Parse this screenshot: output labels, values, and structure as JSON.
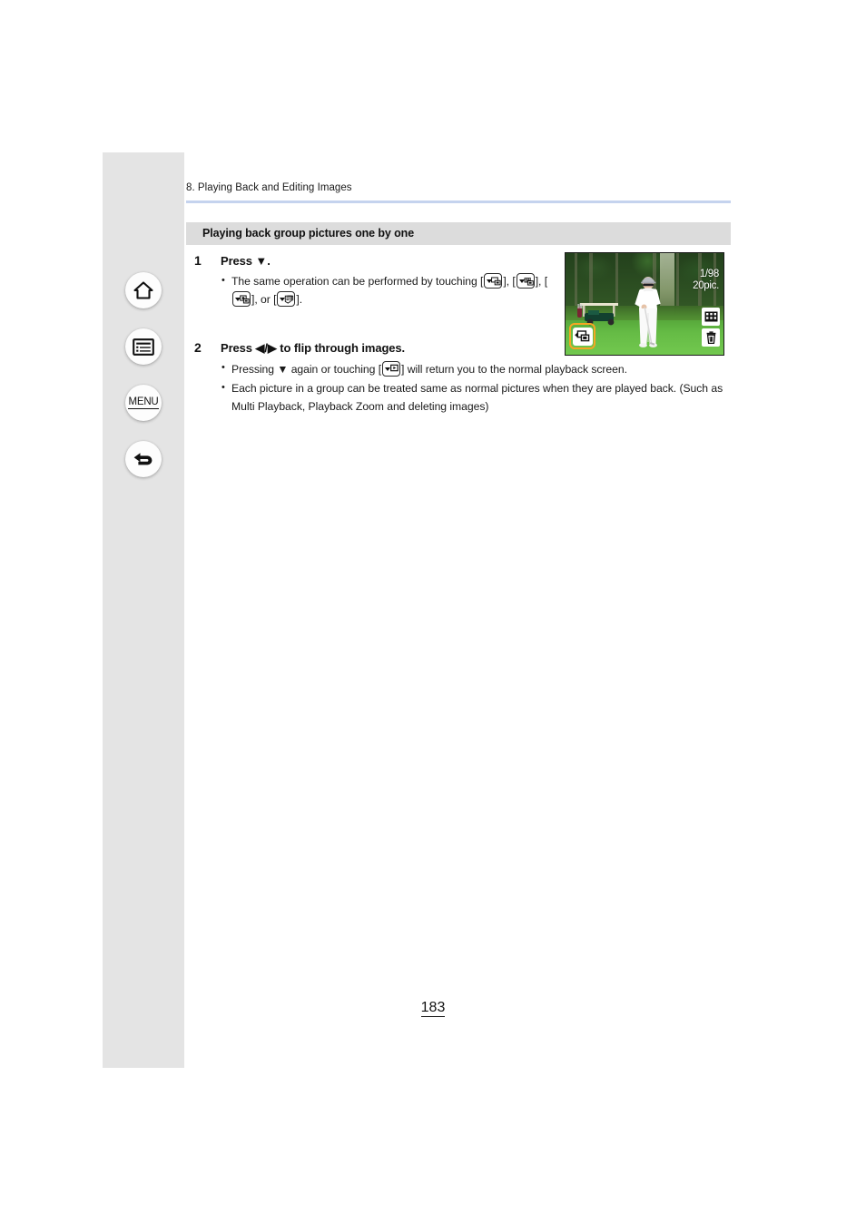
{
  "nav": {
    "items": [
      {
        "name": "home",
        "label": "Home",
        "icon": "home-icon"
      },
      {
        "name": "contents",
        "label": "Contents",
        "icon": "list-icon"
      },
      {
        "name": "menu",
        "label": "MENU",
        "icon": "menu-text"
      },
      {
        "name": "back",
        "label": "Back",
        "icon": "back-arrow-icon"
      }
    ]
  },
  "header": {
    "chapter": "8. Playing Back and Editing Images"
  },
  "section": {
    "title": "Playing back group pictures one by one"
  },
  "steps": [
    {
      "number": "1",
      "heading": "Press ▼.",
      "bullets": [
        {
          "pre": "The same operation can be performed by touching [",
          "mid1": "], [",
          "mid2": "], [",
          "mid3": "], or [",
          "post": "]."
        }
      ]
    },
    {
      "number": "2",
      "heading": "Press ◀/▶ to flip through images.",
      "bullets": [
        {
          "pre": "Pressing ▼ again or touching [",
          "post": "] will return you to the normal playback screen."
        },
        {
          "text": "Each picture in a group can be treated same as normal pictures when they are played back. (Such as Multi Playback, Playback Zoom and deleting images)"
        }
      ]
    }
  ],
  "camera_screen": {
    "picture_count": "1/98",
    "picture_total": "20pic.",
    "icons": {
      "play_mode": "playback-mode-icon",
      "group_chip": "group-up-icon",
      "multi_playback": "multi-playback-icon",
      "delete": "trash-icon",
      "group_play_one_by_one": "group-play-one-by-one-icon"
    },
    "highlight_color": "#f5a623"
  },
  "footer": {
    "page_number": "183"
  },
  "colors": {
    "rail": "#e4e4e4",
    "section_bar": "#dcdcdc",
    "header_rule": "#c5d3ee",
    "highlight": "#f5a623"
  }
}
